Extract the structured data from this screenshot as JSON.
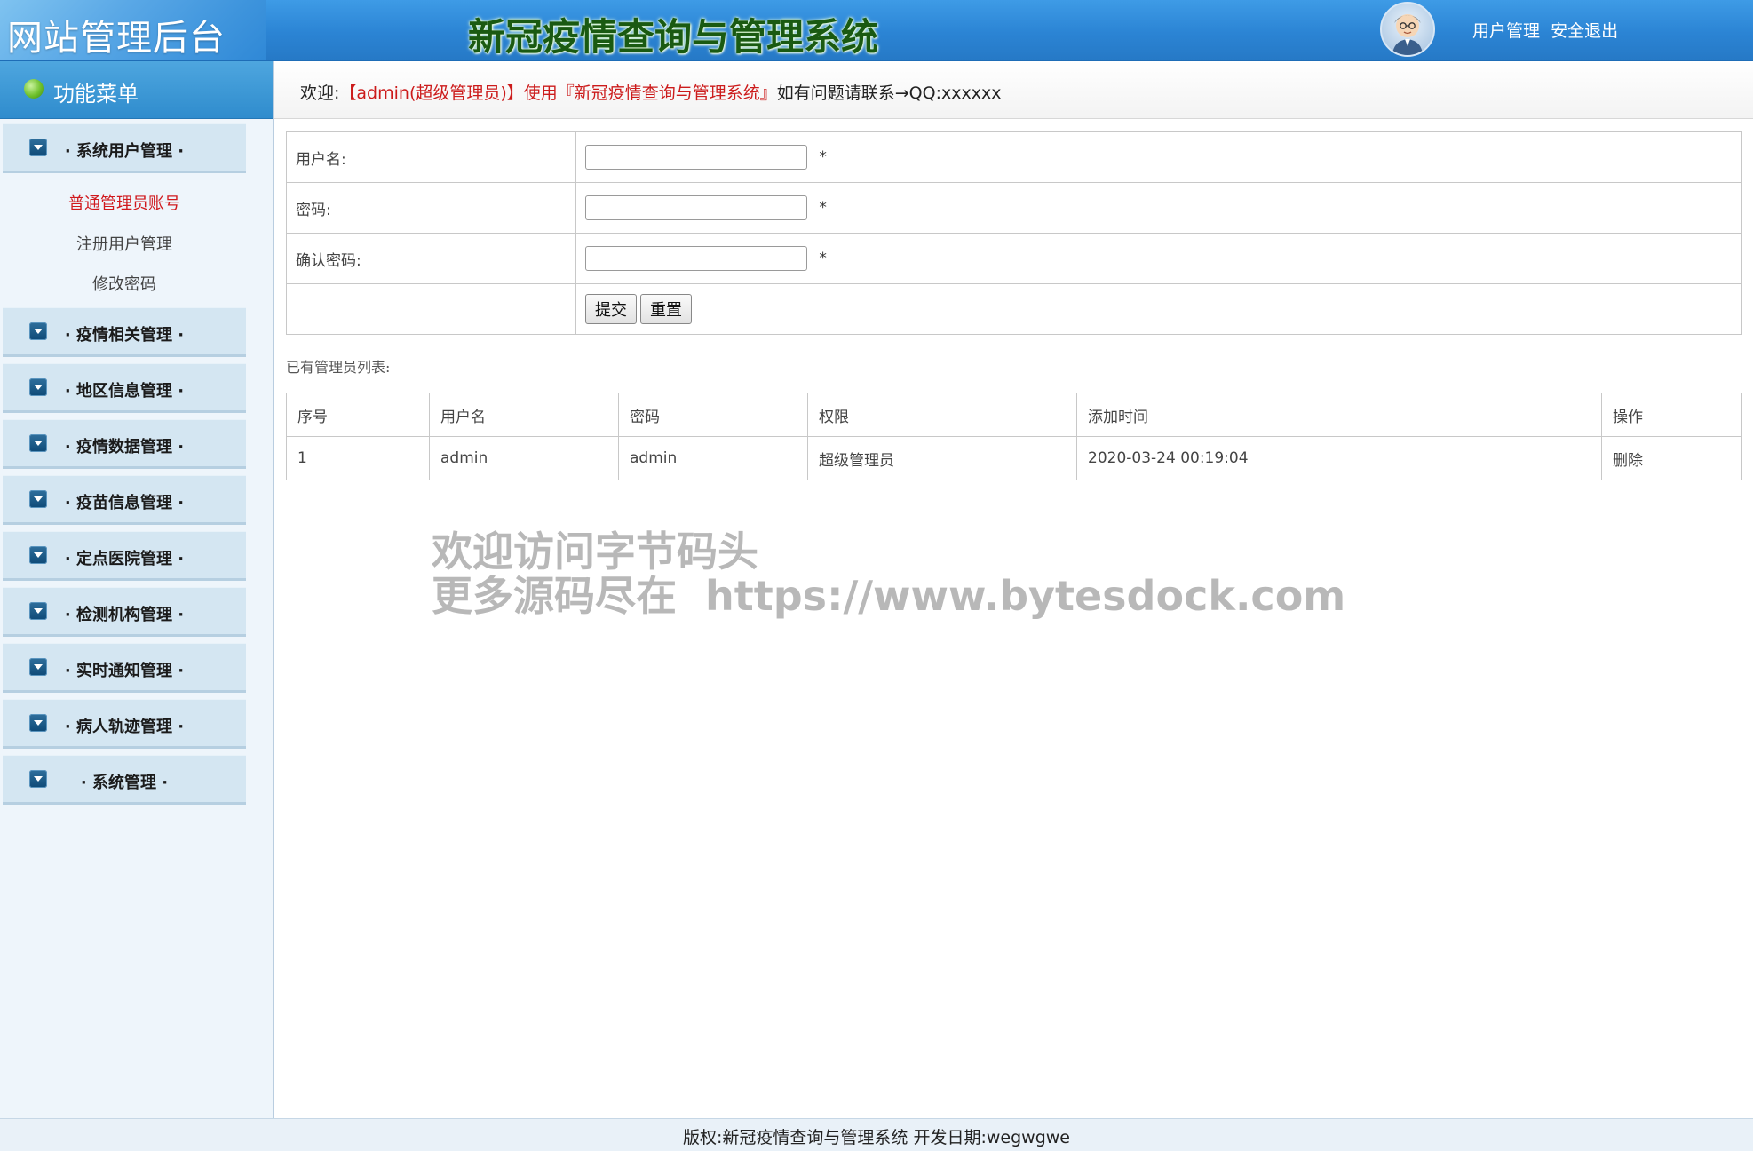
{
  "header": {
    "logo": "网站管理后台",
    "system_title": "新冠疫情查询与管理系统",
    "links": [
      "用户管理",
      "安全退出"
    ]
  },
  "sidebar": {
    "title": "功能菜单",
    "groups": [
      {
        "label": "· 系统用户管理 ·",
        "items": [
          "普通管理员账号",
          "注册用户管理",
          "修改密码"
        ]
      },
      {
        "label": "· 疫情相关管理 ·"
      },
      {
        "label": "· 地区信息管理 ·"
      },
      {
        "label": "· 疫情数据管理 ·"
      },
      {
        "label": "· 疫苗信息管理 ·"
      },
      {
        "label": "· 定点医院管理 ·"
      },
      {
        "label": "· 检测机构管理 ·"
      },
      {
        "label": "· 实时通知管理 ·"
      },
      {
        "label": "· 病人轨迹管理 ·"
      },
      {
        "label": "· 系统管理 ·"
      }
    ]
  },
  "welcome": {
    "prefix": "欢迎:",
    "user": "【admin(超级管理员)】使用『新冠疫情查询与管理系统』",
    "suffix": "如有问题请联系→QQ:xxxxxx"
  },
  "form": {
    "username_label": "用户名:",
    "password_label": "密码:",
    "confirm_label": "确认密码:",
    "required_mark": "*",
    "submit_label": "提交",
    "reset_label": "重置"
  },
  "list": {
    "caption": "已有管理员列表:",
    "columns": [
      "序号",
      "用户名",
      "密码",
      "权限",
      "添加时间",
      "操作"
    ],
    "rows": [
      [
        "1",
        "admin",
        "admin",
        "超级管理员",
        "2020-03-24 00:19:04",
        "删除"
      ]
    ]
  },
  "watermark": {
    "line1": "欢迎访问字节码头",
    "line2": "更多源码尽在  https://www.bytesdock.com"
  },
  "footer": {
    "text": "版权:新冠疫情查询与管理系统 开发日期:wegwgwe"
  }
}
